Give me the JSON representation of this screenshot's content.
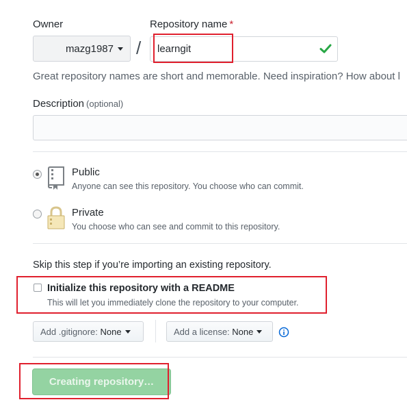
{
  "owner": {
    "label": "Owner",
    "value": "mazg1987"
  },
  "repository": {
    "label": "Repository name",
    "required_mark": "*",
    "value": "learngit",
    "valid_icon": "check-icon"
  },
  "separator": "/",
  "hint": "Great repository names are short and memorable. Need inspiration? How about l",
  "description": {
    "label": "Description",
    "optional": "(optional)",
    "value": ""
  },
  "visibility": {
    "selected": "public",
    "public": {
      "title": "Public",
      "subtitle": "Anyone can see this repository. You choose who can commit.",
      "icon": "repo-book-icon"
    },
    "private": {
      "title": "Private",
      "subtitle": "You choose who can see and commit to this repository.",
      "icon": "lock-icon"
    }
  },
  "skip_text": "Skip this step if you’re importing an existing repository.",
  "readme": {
    "checked": false,
    "title": "Initialize this repository with a README",
    "subtitle": "This will let you immediately clone the repository to your computer."
  },
  "gitignore": {
    "prefix": "Add .gitignore:",
    "value": "None"
  },
  "license": {
    "prefix": "Add a license:",
    "value": "None"
  },
  "info_icon": "info-icon",
  "submit": {
    "label": "Creating repository…"
  },
  "colors": {
    "highlight_box": "#e01f2d",
    "submit_bg": "#94d3a2",
    "check": "#28a745",
    "info": "#0366d6"
  }
}
